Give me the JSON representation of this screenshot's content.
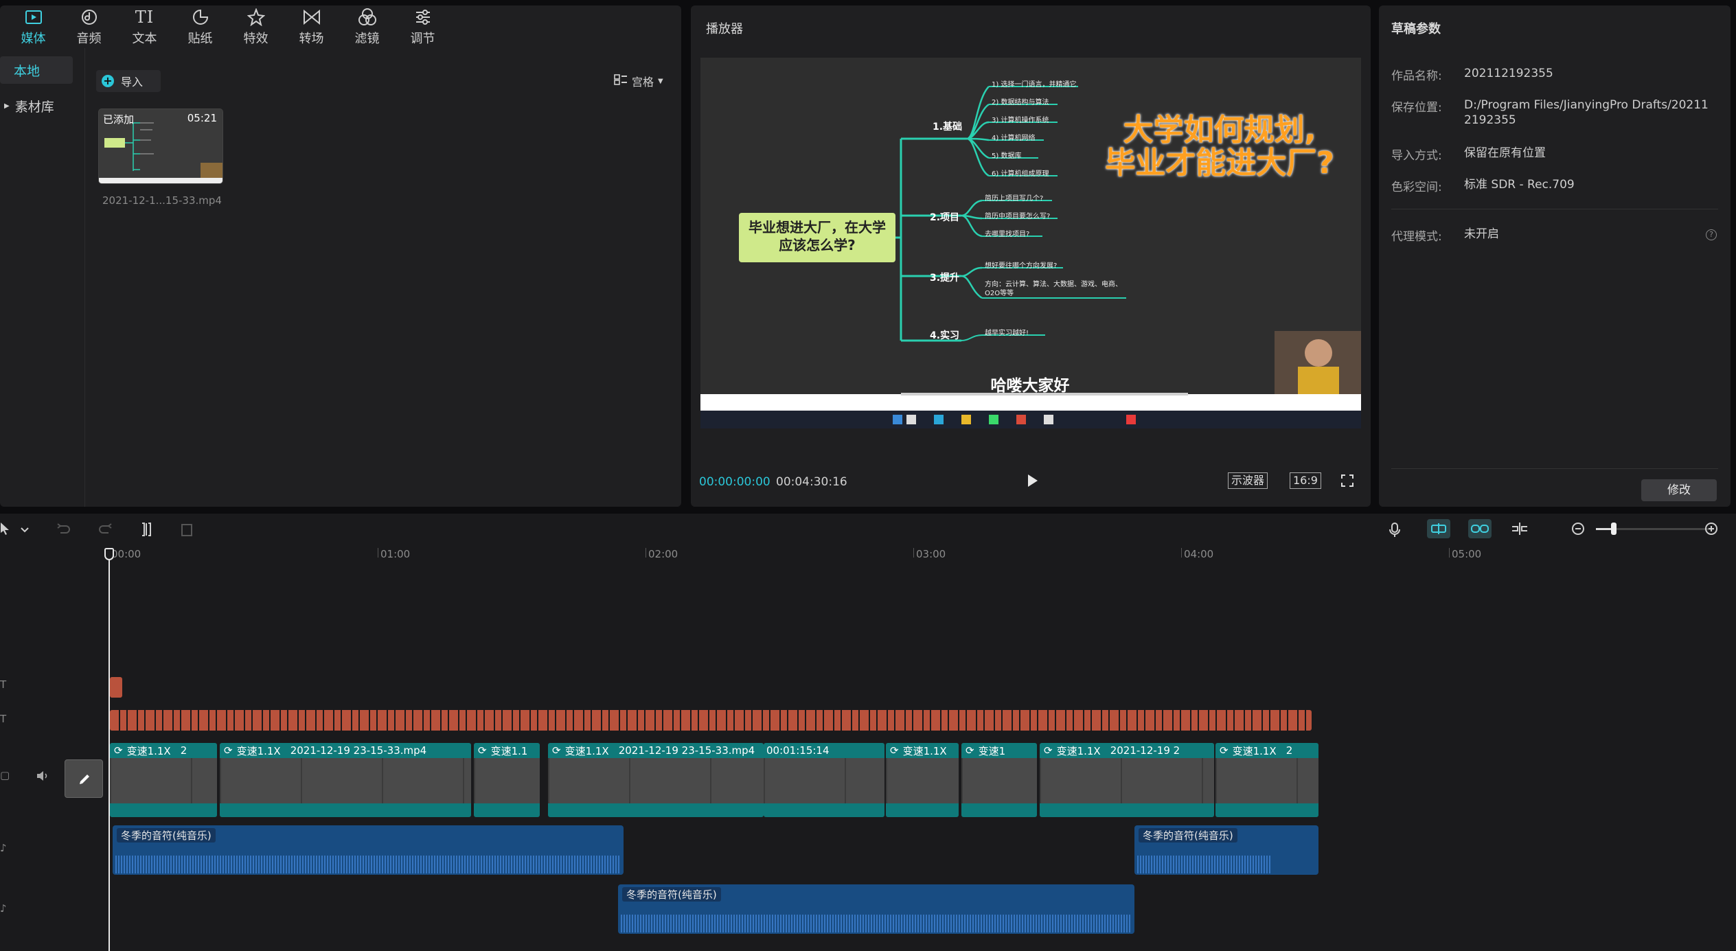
{
  "media": {
    "tabs": [
      {
        "label": "媒体",
        "icon": "media-icon"
      },
      {
        "label": "音频",
        "icon": "audio-icon"
      },
      {
        "label": "文本",
        "icon": "text-icon"
      },
      {
        "label": "贴纸",
        "icon": "sticker-icon"
      },
      {
        "label": "特效",
        "icon": "effects-icon"
      },
      {
        "label": "转场",
        "icon": "transition-icon"
      },
      {
        "label": "滤镜",
        "icon": "filter-icon"
      },
      {
        "label": "调节",
        "icon": "adjust-icon"
      }
    ],
    "nav": {
      "local": "本地",
      "library": "素材库"
    },
    "import_label": "导入",
    "grid_label": "宫格",
    "item": {
      "added": "已添加",
      "duration": "05:21",
      "name": "2021-12-1...15-33.mp4"
    }
  },
  "player": {
    "title": "播放器",
    "current_time": "00:00:00:00",
    "total_time": "00:04:30:16",
    "scope_label": "示波器",
    "ratio_label": "16:9",
    "video": {
      "title_line1": "大学如何规划,",
      "title_line2": "毕业才能进大厂?",
      "root_text": "毕业想进大厂，在大学应该怎么学?",
      "branch1": "1.基础",
      "branch1_items": [
        "1) 选择一门语言，并精通它",
        "2) 数据结构与算法",
        "3) 计算机操作系统",
        "4) 计算机网络",
        "5) 数据库",
        "6) 计算机组成原理"
      ],
      "branch2": "2.项目",
      "branch2_items": [
        "简历上项目写几个?",
        "简历中项目要怎么写?",
        "去哪里找项目?"
      ],
      "branch3": "3.提升",
      "branch3_items": [
        "想好要往哪个方向发展?",
        "方向：云计算、算法、大数据、游戏、电商、O2O等等"
      ],
      "branch4": "4.实习",
      "branch4_items": [
        "越早实习越好!"
      ],
      "subtitle": "哈喽大家好"
    }
  },
  "params": {
    "title": "草稿参数",
    "rows": [
      {
        "key": "作品名称:",
        "value": "202112192355"
      },
      {
        "key": "保存位置:",
        "value": "D:/Program Files/JianyingPro Drafts/202112192355"
      },
      {
        "key": "导入方式:",
        "value": "保留在原有位置"
      },
      {
        "key": "色彩空间:",
        "value": "标准 SDR - Rec.709"
      }
    ],
    "proxy": {
      "key": "代理模式:",
      "value": "未开启"
    },
    "modify_label": "修改"
  },
  "timeline": {
    "ticks": [
      "00:00",
      "01:00",
      "02:00",
      "03:00",
      "04:00",
      "05:00"
    ],
    "video_clips": [
      {
        "speed": "变速1.1X",
        "extra": "2"
      },
      {
        "speed": "变速1.1X",
        "extra": "2021-12-19 23-15-33.mp4"
      },
      {
        "speed": "变速1.1",
        "extra": ""
      },
      {
        "speed": "变速1.1X",
        "extra": "2021-12-19 23-15-33.mp4"
      },
      {
        "speed": "",
        "extra": "00:01:15:14"
      },
      {
        "speed": "变速1.1X",
        "extra": ""
      },
      {
        "speed": "变速1",
        "extra": ""
      },
      {
        "speed": "变速1.1X",
        "extra": "2021-12-19 2"
      },
      {
        "speed": "变速1.1X",
        "extra": "2"
      }
    ],
    "audio_clips": [
      {
        "label": "冬季的音符(纯音乐)"
      },
      {
        "label": "冬季的音符(纯音乐)"
      },
      {
        "label": "冬季的音符(纯音乐)"
      }
    ]
  },
  "colors": {
    "accent": "#2bc6d8",
    "video_clip": "#0f7a7a",
    "audio_clip": "#184c82",
    "text_clip": "#b9523c"
  }
}
